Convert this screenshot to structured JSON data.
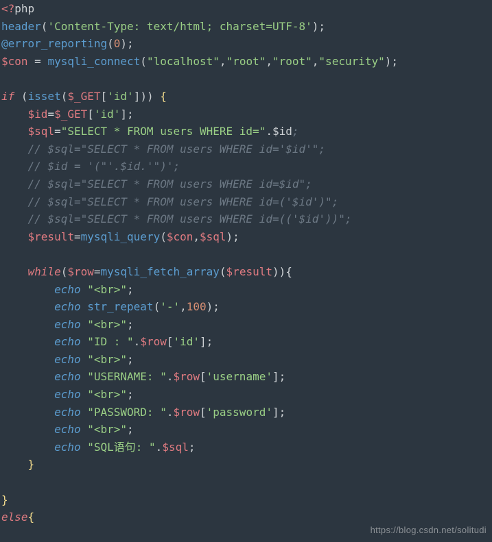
{
  "lines": {
    "l01a": "<?",
    "l01b": "php",
    "l02a": "header",
    "l02b": "(",
    "l02c": "'Content-Type: text/html; charset=UTF-8'",
    "l02d": ");",
    "l03a": "@error_reporting",
    "l03b": "(",
    "l03c": "0",
    "l03d": ");",
    "l04a": "$con",
    "l04b": " = ",
    "l04c": "mysqli_connect",
    "l04d": "(",
    "l04e": "\"localhost\"",
    "l04f": ",",
    "l04g": "\"root\"",
    "l04h": ",",
    "l04i": "\"root\"",
    "l04j": ",",
    "l04k": "\"security\"",
    "l04l": ");",
    "l05": "",
    "l06a": "if",
    "l06b": " (",
    "l06c": "isset",
    "l06d": "(",
    "l06e": "$_GET",
    "l06f": "[",
    "l06g": "'id'",
    "l06h": "])) ",
    "l06i": "{",
    "l07a": "    ",
    "l07b": "$id",
    "l07c": "=",
    "l07d": "$_GET",
    "l07e": "[",
    "l07f": "'id'",
    "l07g": "];",
    "l08a": "    ",
    "l08b": "$sql",
    "l08c": "=",
    "l08d": "\"SELECT * FROM users WHERE id=\"",
    "l08e": ".",
    "l08f": "$id",
    "l08g": ";",
    "l09": "    // $sql=\"SELECT * FROM users WHERE id='$id'\";",
    "l10": "    // $id = '(\"'.$id.'\")';",
    "l11": "    // $sql=\"SELECT * FROM users WHERE id=$id\";",
    "l12": "    // $sql=\"SELECT * FROM users WHERE id=('$id')\";",
    "l13": "    // $sql=\"SELECT * FROM users WHERE id=(('$id'))\";",
    "l14a": "    ",
    "l14b": "$result",
    "l14c": "=",
    "l14d": "mysqli_query",
    "l14e": "(",
    "l14f": "$con",
    "l14g": ",",
    "l14h": "$sql",
    "l14i": ");",
    "l15": "",
    "l16a": "    ",
    "l16b": "while",
    "l16c": "(",
    "l16d": "$row",
    "l16e": "=",
    "l16f": "mysqli_fetch_array",
    "l16g": "(",
    "l16h": "$result",
    "l16i": ")){",
    "l17a": "        ",
    "l17b": "echo",
    "l17c": " ",
    "l17d": "\"<br>\"",
    "l17e": ";",
    "l18a": "        ",
    "l18b": "echo",
    "l18c": " ",
    "l18d": "str_repeat",
    "l18e": "(",
    "l18f": "'-'",
    "l18g": ",",
    "l18h": "100",
    "l18i": ");",
    "l19a": "        ",
    "l19b": "echo",
    "l19c": " ",
    "l19d": "\"<br>\"",
    "l19e": ";",
    "l20a": "        ",
    "l20b": "echo",
    "l20c": " ",
    "l20d": "\"ID : \"",
    "l20e": ".",
    "l20f": "$row",
    "l20g": "[",
    "l20h": "'id'",
    "l20i": "];",
    "l21a": "        ",
    "l21b": "echo",
    "l21c": " ",
    "l21d": "\"<br>\"",
    "l21e": ";",
    "l22a": "        ",
    "l22b": "echo",
    "l22c": " ",
    "l22d": "\"USERNAME: \"",
    "l22e": ".",
    "l22f": "$row",
    "l22g": "[",
    "l22h": "'username'",
    "l22i": "];",
    "l23a": "        ",
    "l23b": "echo",
    "l23c": " ",
    "l23d": "\"<br>\"",
    "l23e": ";",
    "l24a": "        ",
    "l24b": "echo",
    "l24c": " ",
    "l24d": "\"PASSWORD: \"",
    "l24e": ".",
    "l24f": "$row",
    "l24g": "[",
    "l24h": "'password'",
    "l24i": "];",
    "l25a": "        ",
    "l25b": "echo",
    "l25c": " ",
    "l25d": "\"<br>\"",
    "l25e": ";",
    "l26a": "        ",
    "l26b": "echo",
    "l26c": " ",
    "l26d": "\"SQL语句: \"",
    "l26e": ".",
    "l26f": "$sql",
    "l26g": ";",
    "l27a": "    ",
    "l27b": "}",
    "l28": "",
    "l29": "}",
    "l30a": "else",
    "l30b": "{"
  },
  "watermark": "https://blog.csdn.net/solitudi"
}
